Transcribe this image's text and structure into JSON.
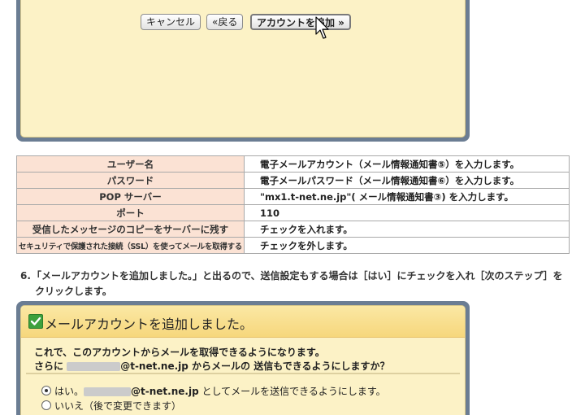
{
  "top_dialog": {
    "cancel_label": "キャンセル",
    "back_label": "«戻る",
    "add_label": "アカウントを追加 »"
  },
  "settings": [
    {
      "key": "ユーザー名",
      "value": "電子メールアカウント（メール情報通知書⑤）を入力します。"
    },
    {
      "key": "パスワード",
      "value": "電子メールパスワード（メール情報通知書⑥）を入力します。"
    },
    {
      "key": "POP サーバー",
      "value": "\"mx1.t-net.ne.jp\"( メール情報通知書③) を入力します。"
    },
    {
      "key": "ポート",
      "value": "110"
    },
    {
      "key": "受信したメッセージのコピーをサーバーに残す",
      "value": "チェックを入れます。"
    },
    {
      "key": "セキュリティで保護された接続（SSL）を使ってメールを取得する",
      "value": "チェックを外します。"
    }
  ],
  "step6": {
    "number": "6.",
    "line1": "「メールアカウントを追加しました。」と出るので、送信設定もする場合は［はい］にチェックを入れ［次のステップ］を",
    "line2": "クリックします。"
  },
  "bottom_dialog": {
    "title": "メールアカウントを追加しました。",
    "line1": "これで、このアカウントからメールを取得できるようになります。",
    "line2_prefix": "さらに",
    "line2_domain": "@t-net.ne.jp",
    "line2_suffix": "からメールの 送信もできるようにしますか？",
    "option_yes_prefix": "はい。",
    "option_yes_domain": "@t-net.ne.jp",
    "option_yes_suffix": "としてメールを送信できるようにします。",
    "option_no": "いいえ（後で変更できます）"
  }
}
